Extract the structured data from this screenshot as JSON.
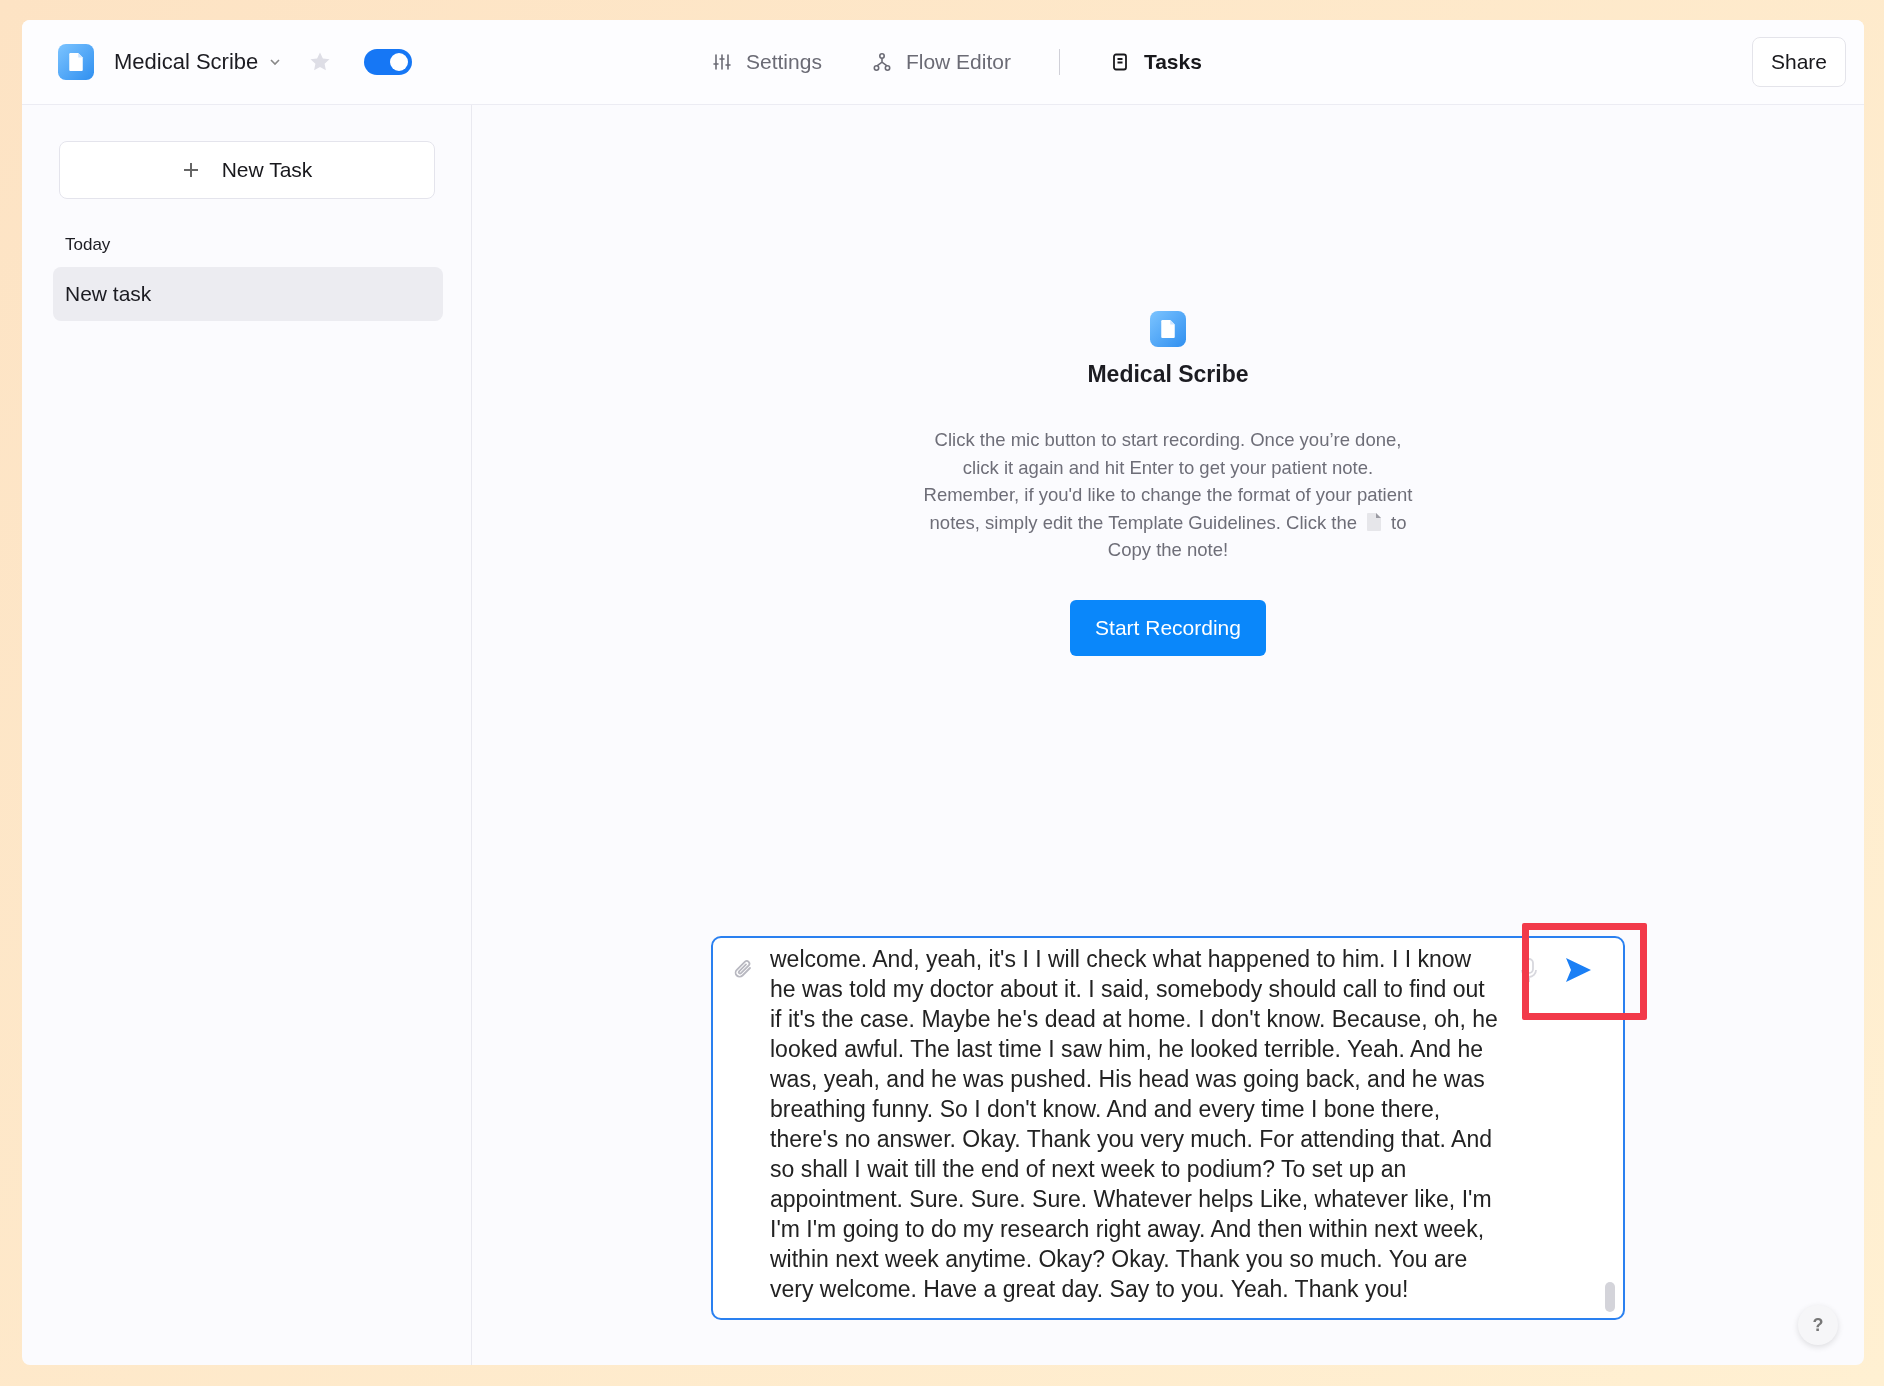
{
  "header": {
    "app_name": "Medical Scribe",
    "starred": false,
    "toggle": {
      "on": true
    },
    "tabs": [
      {
        "label": "Settings",
        "selected": false
      },
      {
        "label": "Flow Editor",
        "selected": false
      },
      {
        "label": "Tasks",
        "selected": true
      }
    ],
    "share_button": "Share"
  },
  "sidebar": {
    "new_task_button": "New Task",
    "group_label": "Today",
    "items": [
      {
        "label": "New task",
        "selected": true
      }
    ]
  },
  "intro": {
    "title": "Medical Scribe",
    "text": "Click the mic button to start recording. Once you’re done,\nclick it again and hit Enter to get your patient note.\nRemember, if you'd like to change the format of your patient",
    "text_before_icon": "notes, simply edit the Template Guidelines. Click the",
    "text_after_icon": "to",
    "last_line": "Copy the note!",
    "button": "Start Recording"
  },
  "composer": {
    "value": "welcome. And, yeah, it's I I will check what happened to him. I I know he was told my doctor about it. I said, somebody should call to find out if it's the case. Maybe he's dead at home. I don't know. Because, oh, he looked awful. The last time I saw him, he looked terrible. Yeah. And he was, yeah, and he was pushed. His head was going back, and he was breathing funny. So I don't know. And and every time I bone there, there's no answer.  Okay. Thank you very much. For attending that. And so shall I wait till the end of next week to podium? To set up an appointment. Sure. Sure. Sure. Whatever helps Like, whatever like, I'm I'm I'm going to do my research right away. And then within next week, within next week anytime. Okay? Okay. Thank you so much. You are very welcome. Have a great day. Say to you. Yeah. Thank you!"
  },
  "help_button": "?"
}
